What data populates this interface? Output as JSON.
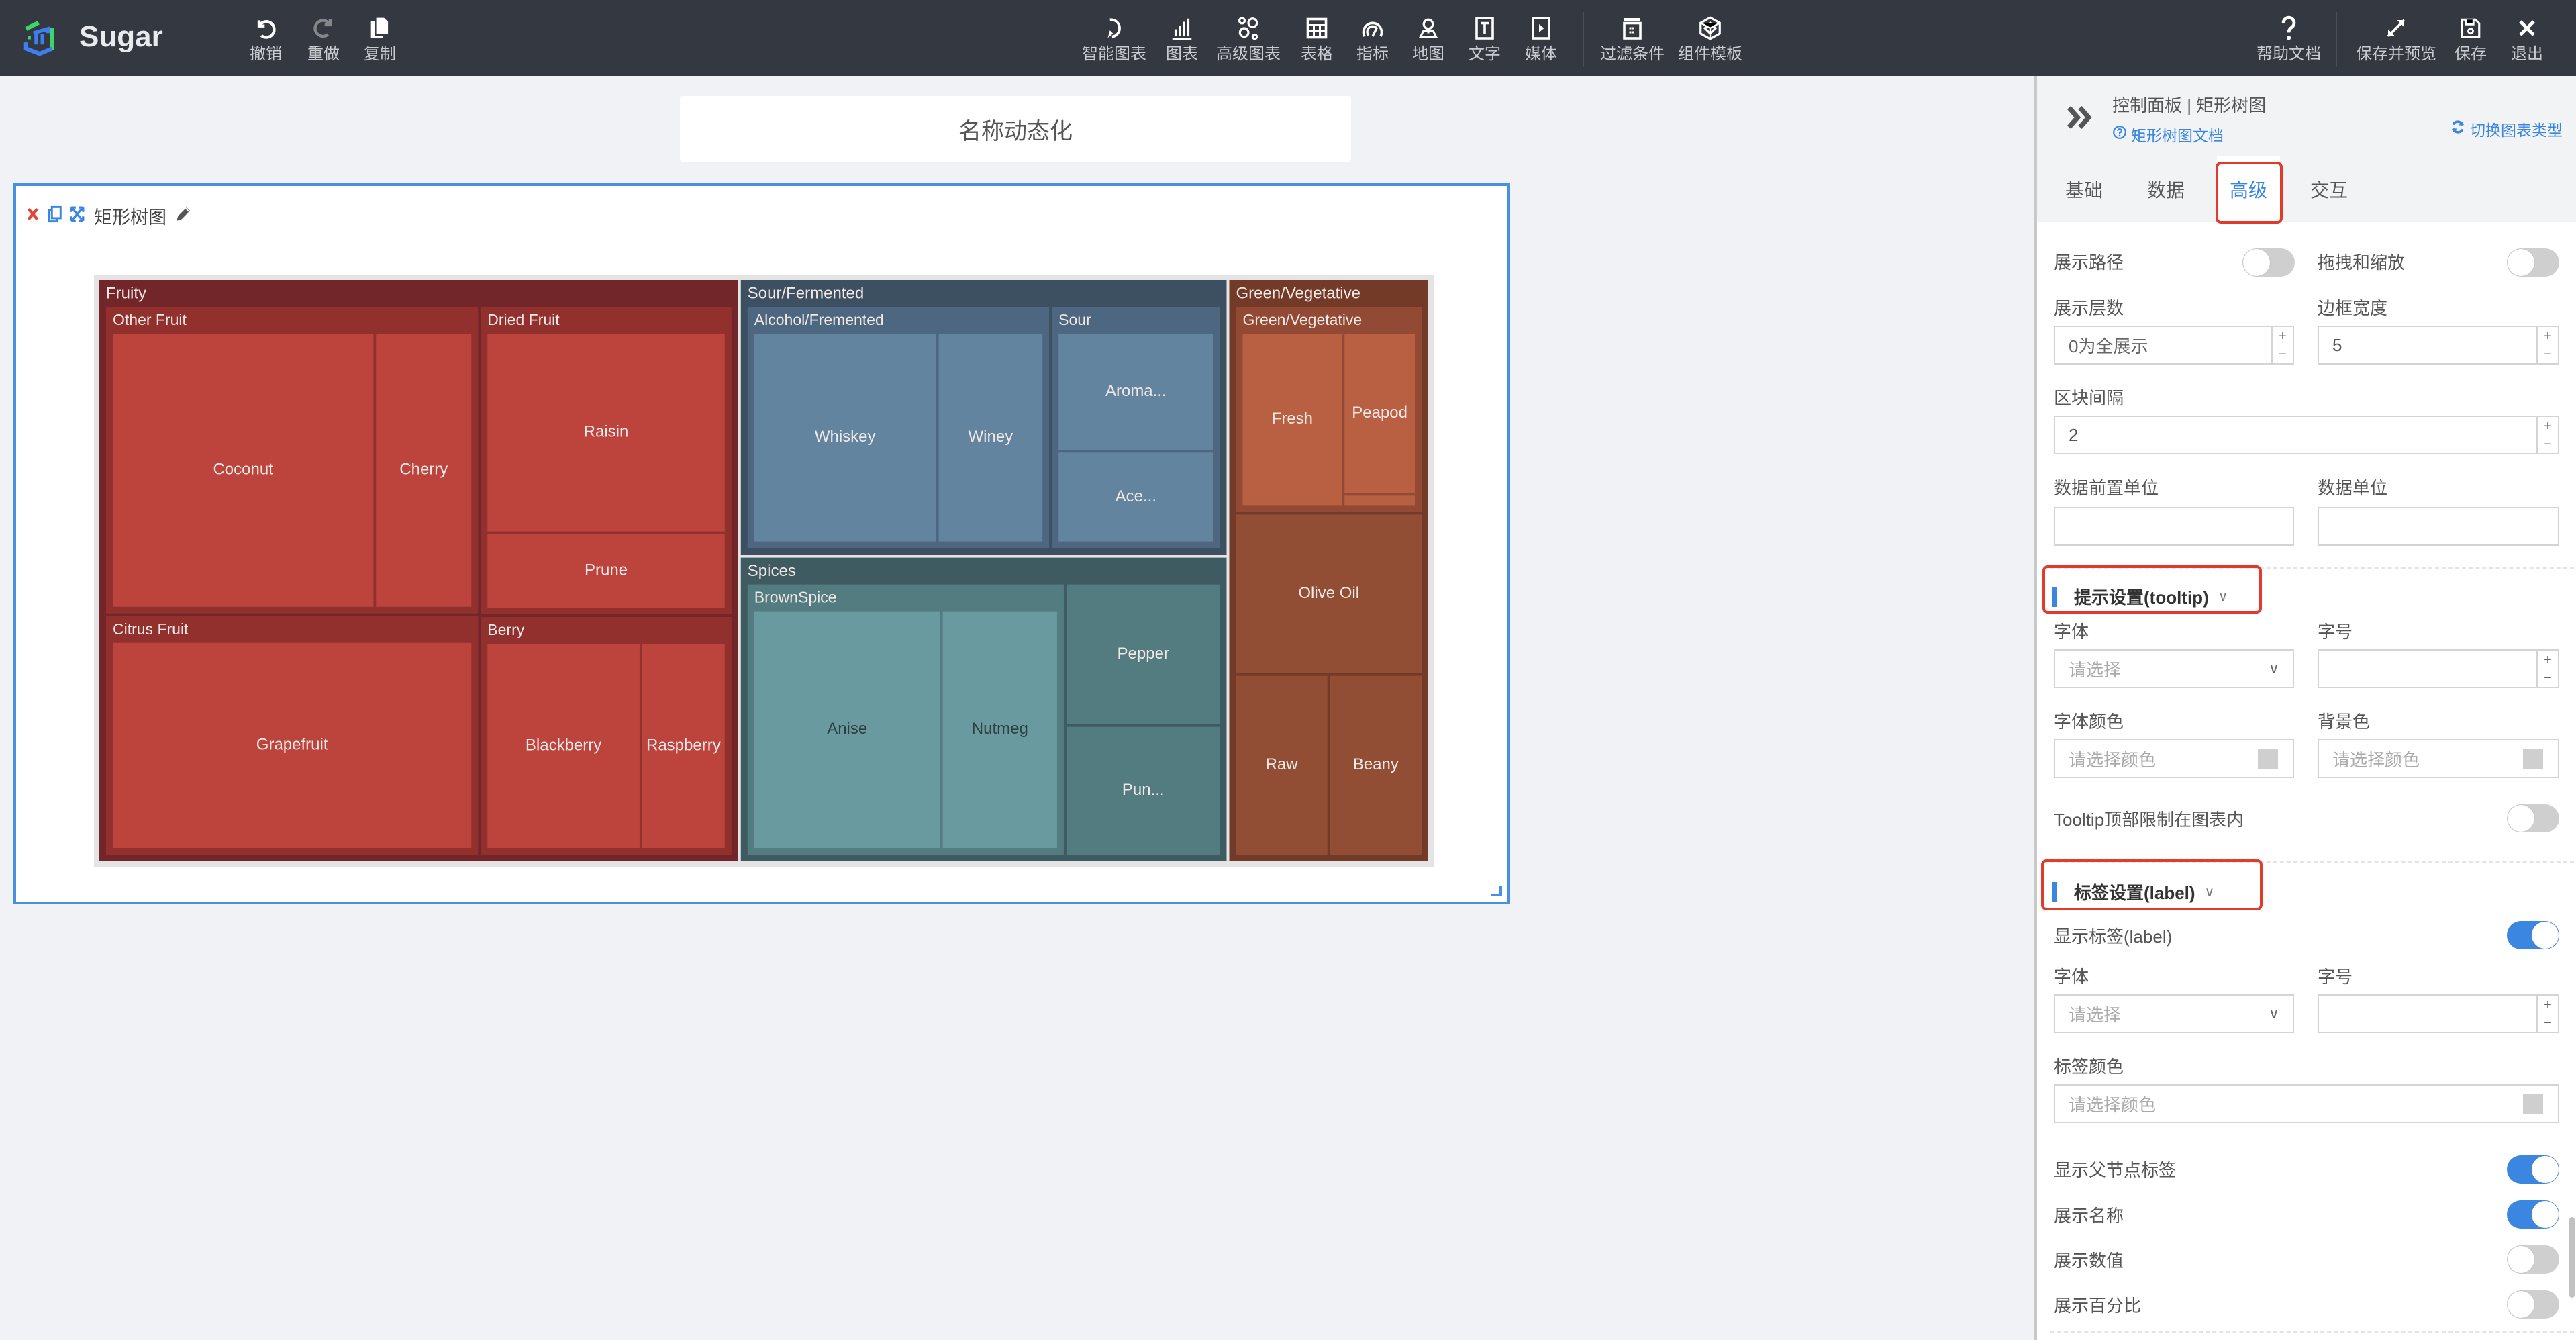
{
  "app": {
    "brand": "Sugar",
    "colors": {
      "toolbar_bg": "#343840",
      "accent": "#3a86e0",
      "highlight": "#e23b2a",
      "canvas_bg": "#f0f2f5"
    }
  },
  "toolbar": {
    "left": [
      {
        "id": "undo",
        "label": "撤销",
        "icon": "undo-icon"
      },
      {
        "id": "redo",
        "label": "重做",
        "icon": "redo-icon"
      },
      {
        "id": "copy",
        "label": "复制",
        "icon": "copy-icon"
      }
    ],
    "center": [
      {
        "id": "smart-chart",
        "label": "智能图表",
        "icon": "smart-chart-icon"
      },
      {
        "id": "chart",
        "label": "图表",
        "icon": "bar-chart-icon"
      },
      {
        "id": "advanced-chart",
        "label": "高级图表",
        "icon": "advanced-chart-icon"
      },
      {
        "id": "table",
        "label": "表格",
        "icon": "table-icon"
      },
      {
        "id": "metric",
        "label": "指标",
        "icon": "gauge-icon"
      },
      {
        "id": "map",
        "label": "地图",
        "icon": "map-pin-icon"
      },
      {
        "id": "text",
        "label": "文字",
        "icon": "text-icon"
      },
      {
        "id": "media",
        "label": "媒体",
        "icon": "media-icon"
      },
      {
        "id": "filter",
        "label": "过滤条件",
        "icon": "filter-icon"
      },
      {
        "id": "template",
        "label": "组件模板",
        "icon": "template-icon"
      }
    ],
    "right": [
      {
        "id": "help",
        "label": "帮助文档",
        "icon": "help-icon"
      },
      {
        "id": "save-preview",
        "label": "保存并预览",
        "icon": "expand-icon"
      },
      {
        "id": "save",
        "label": "保存",
        "icon": "save-icon"
      },
      {
        "id": "exit",
        "label": "退出",
        "icon": "close-icon"
      }
    ]
  },
  "canvas": {
    "title": "名称动态化",
    "widget": {
      "title": "矩形树图"
    }
  },
  "chart_data": {
    "type": "treemap",
    "title": "矩形树图",
    "show_parent_labels": true,
    "show_names": true,
    "show_values": false,
    "tree": [
      {
        "name": "Fruity",
        "color": "#72262a",
        "children": [
          {
            "name": "Other Fruit",
            "color": "#92302e",
            "children": [
              {
                "name": "Coconut",
                "value": 4.3
              },
              {
                "name": "Cherry",
                "value": 1.6
              }
            ]
          },
          {
            "name": "Dried Fruit",
            "color": "#92302e",
            "children": [
              {
                "name": "Raisin",
                "value": 2.9
              },
              {
                "name": "Prune",
                "value": 1.1
              }
            ]
          },
          {
            "name": "Citrus Fruit",
            "color": "#92302e",
            "children": [
              {
                "name": "Grapefruit",
                "value": 4.6
              }
            ]
          },
          {
            "name": "Berry",
            "color": "#92302e",
            "children": [
              {
                "name": "Blackberry",
                "value": 2.0
              },
              {
                "name": "Raspberry",
                "value": 1.1
              }
            ]
          }
        ]
      },
      {
        "name": "Sour/Fermented",
        "color": "#3d5062",
        "children": [
          {
            "name": "Alcohol/Fremented",
            "color": "#4c677f",
            "children": [
              {
                "name": "Whiskey",
                "value": 2.6
              },
              {
                "name": "Winey",
                "value": 1.5
              }
            ]
          },
          {
            "name": "Sour",
            "color": "#4c677f",
            "children": [
              {
                "name": "Aroma...",
                "value": 1.3
              },
              {
                "name": "Ace...",
                "value": 1.0
              }
            ]
          }
        ]
      },
      {
        "name": "Spices",
        "color": "#3e5b62",
        "children": [
          {
            "name": "BrownSpice",
            "color": "#527c80",
            "children": [
              {
                "name": "Anise",
                "value": 2.9
              },
              {
                "name": "Nutmeg",
                "value": 1.8
              }
            ]
          },
          {
            "name": "Pepper",
            "value": 1.2
          },
          {
            "name": "Pun...",
            "value": 1.1
          }
        ]
      },
      {
        "name": "Green/Vegetative",
        "color": "#733a27",
        "children": [
          {
            "name": "Green/Vegetative",
            "color": "#924a35",
            "children": [
              {
                "name": "Fresh",
                "value": 1.2
              },
              {
                "name": "Peapod",
                "value": 0.8
              },
              {
                "name": "",
                "value": 0.06
              }
            ]
          },
          {
            "name": "Olive Oil",
            "value": 1.6
          },
          {
            "name": "Raw",
            "value": 0.9
          },
          {
            "name": "Beany",
            "value": 0.9
          }
        ]
      }
    ],
    "leaf_colors": {
      "Fruity": "#bc443c",
      "Sour/Fermented": "#62849f",
      "Spices": "#699aa0",
      "Spices-direct": "#527c80",
      "Green/Vegetative": "#b95f42",
      "Green-direct": "#924d35"
    }
  },
  "panel": {
    "title": "控制面板 | 矩形树图",
    "doc_link": "矩形树图文档",
    "switch_link": "切换图表类型",
    "tabs": [
      {
        "label": "基础",
        "active": false
      },
      {
        "label": "数据",
        "active": false
      },
      {
        "label": "高级",
        "active": true
      },
      {
        "label": "交互",
        "active": false
      }
    ],
    "general": {
      "show_path": {
        "label": "展示路径",
        "on": false
      },
      "drag_zoom": {
        "label": "拖拽和缩放",
        "on": false
      },
      "levels": {
        "label": "展示层数",
        "value": "",
        "placeholder": "0为全展示"
      },
      "border_width": {
        "label": "边框宽度",
        "value": "5"
      },
      "gap": {
        "label": "区块间隔",
        "value": "2"
      },
      "prefix_unit": {
        "label": "数据前置单位",
        "value": ""
      },
      "unit": {
        "label": "数据单位",
        "value": ""
      }
    },
    "tooltip": {
      "title": "提示设置(tooltip)",
      "font": {
        "label": "字体",
        "placeholder": "请选择"
      },
      "font_size": {
        "label": "字号",
        "value": ""
      },
      "font_color": {
        "label": "字体颜色",
        "placeholder": "请选择颜色"
      },
      "bg_color": {
        "label": "背景色",
        "placeholder": "请选择颜色"
      },
      "confine": {
        "label": "Tooltip顶部限制在图表内",
        "on": false
      }
    },
    "label": {
      "title": "标签设置(label)",
      "show_label": {
        "label": "显示标签(label)",
        "on": true
      },
      "font": {
        "label": "字体",
        "placeholder": "请选择"
      },
      "font_size": {
        "label": "字号",
        "value": ""
      },
      "color": {
        "label": "标签颜色",
        "placeholder": "请选择颜色"
      },
      "show_parent": {
        "label": "显示父节点标签",
        "on": true
      },
      "show_name": {
        "label": "展示名称",
        "on": true
      },
      "show_value": {
        "label": "展示数值",
        "on": false
      },
      "show_percent": {
        "label": "展示百分比",
        "on": false
      }
    },
    "stepper": {
      "plus": "+",
      "minus": "−"
    }
  }
}
